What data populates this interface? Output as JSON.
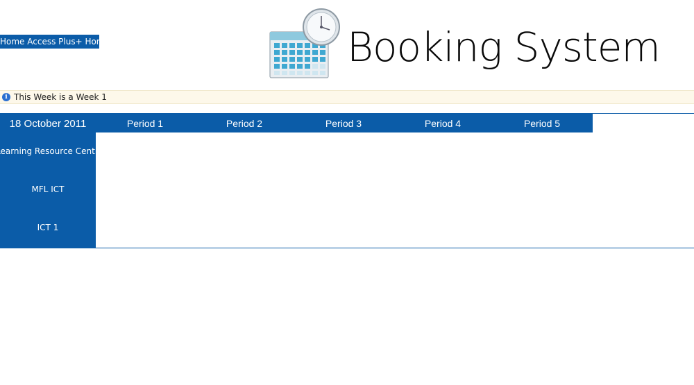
{
  "nav": {
    "home_link": "Home Access Plus+ Home"
  },
  "header": {
    "title": "Booking System",
    "logo_icon": "calendar-clock-icon"
  },
  "info": {
    "icon": "info-icon",
    "message": "This Week is a Week 1"
  },
  "booking_grid": {
    "date": "18 October 2011",
    "periods": [
      "Period 1",
      "Period 2",
      "Period 3",
      "Period 4",
      "Period 5"
    ],
    "rooms": [
      "Learning Resource Centre I",
      "MFL ICT",
      "ICT 1"
    ]
  },
  "colors": {
    "accent": "#0b5ca8",
    "info_bg": "#fdf8ea"
  }
}
